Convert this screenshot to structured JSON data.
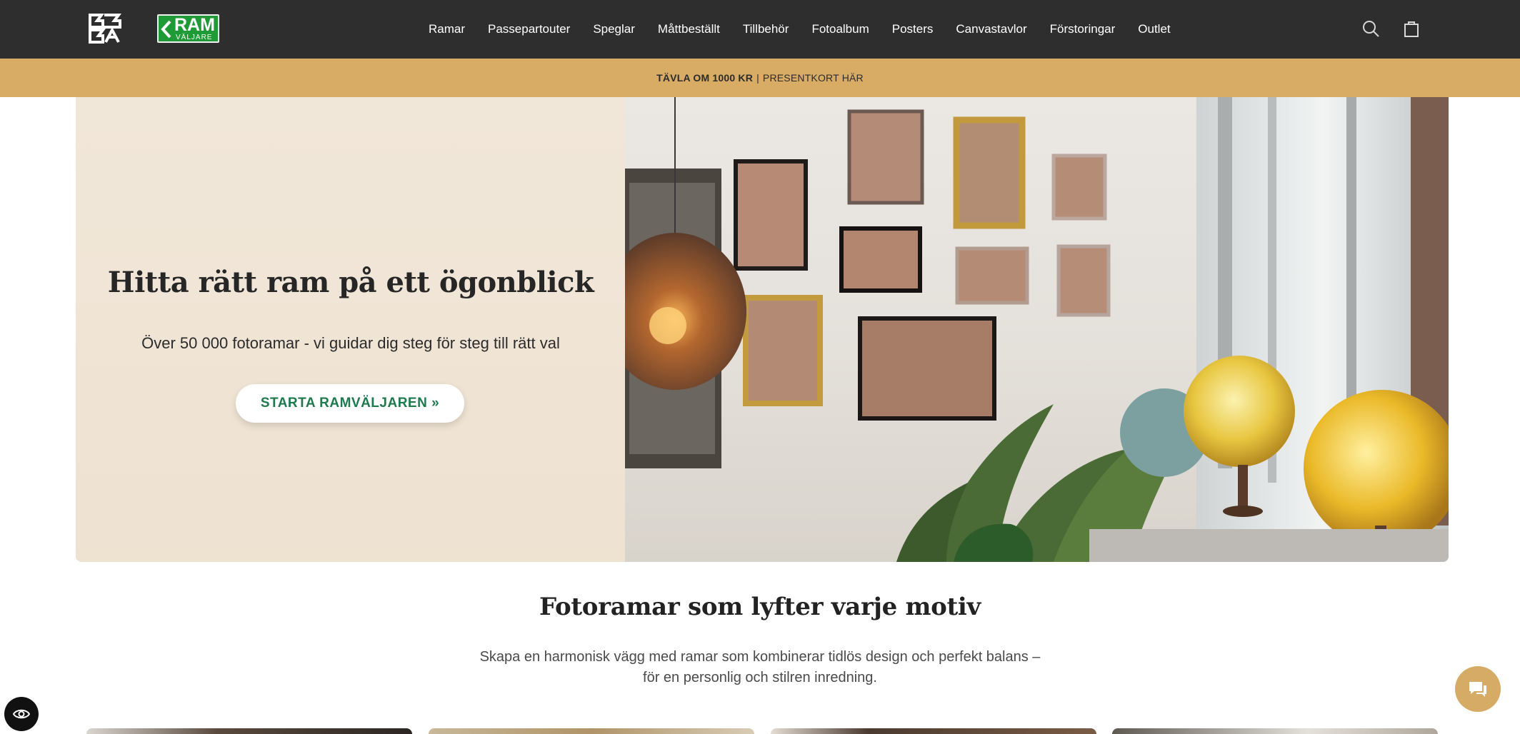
{
  "header": {
    "brand_logo_text": "BGA",
    "partner_logo": {
      "line1": "RAM",
      "line2": "VÄLJARE"
    },
    "nav": [
      "Ramar",
      "Passepartouter",
      "Speglar",
      "Måttbeställt",
      "Tillbehör",
      "Fotoalbum",
      "Posters",
      "Canvastavlor",
      "Förstoringar",
      "Outlet"
    ],
    "icons": [
      "search-icon",
      "bag-icon"
    ]
  },
  "announcement": {
    "bold": "TÄVLA OM 1000 KR",
    "separator": "|",
    "rest": "PRESENTKORT HÄR"
  },
  "hero": {
    "title": "Hitta rätt ram på ett ögonblick",
    "subtitle": "Över 50 000 fotoramar - vi guidar dig steg för steg till rätt val",
    "cta": "STARTA RAMVÄLJAREN »"
  },
  "section": {
    "title": "Fotoramar som lyfter varje motiv",
    "text_line1": "Skapa en harmonisk vägg med ramar som kombinerar tidlös design och perfekt balans –",
    "text_line2": "för en personlig och stilren inredning."
  },
  "colors": {
    "header_bg": "#2e2e2e",
    "announcement_bg": "#d9ac66",
    "hero_left_bg": "#f1e7d9",
    "cta_text": "#1d7a4c",
    "chat_bg": "#d6ab66"
  }
}
